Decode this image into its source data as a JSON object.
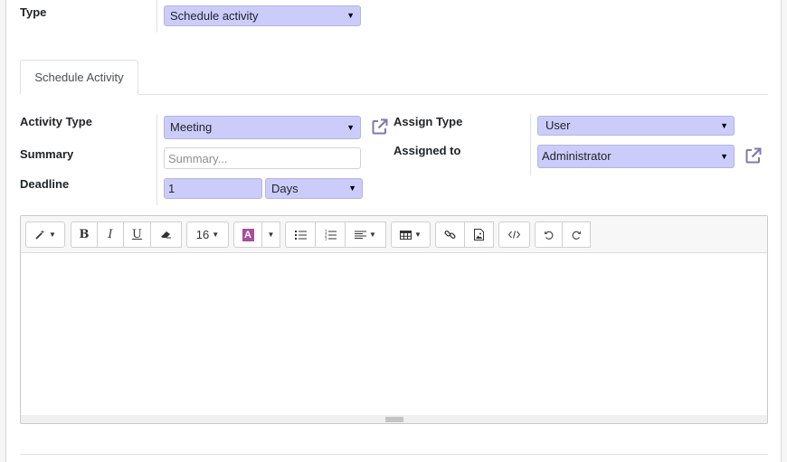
{
  "type_field": {
    "label": "Type",
    "value": "Schedule activity"
  },
  "tabs": [
    {
      "label": "Schedule Activity"
    }
  ],
  "activity_type": {
    "label": "Activity Type",
    "value": "Meeting"
  },
  "summary": {
    "label": "Summary",
    "placeholder": "Summary...",
    "value": ""
  },
  "deadline": {
    "label": "Deadline",
    "value": "1",
    "unit": "Days"
  },
  "assign_type": {
    "label": "Assign Type",
    "value": "User"
  },
  "assigned_to": {
    "label": "Assigned to",
    "value": "Administrator"
  },
  "toolbar": {
    "font_size": "16",
    "icons": [
      "magic-wand-icon",
      "bold-icon",
      "italic-icon",
      "underline-icon",
      "eraser-icon",
      "font-color-icon",
      "bullet-list-icon",
      "numbered-list-icon",
      "align-icon",
      "table-icon",
      "link-icon",
      "image-icon",
      "code-view-icon",
      "undo-icon",
      "redo-icon"
    ],
    "bold": "B",
    "italic": "I",
    "underline": "U",
    "color_letter": "A"
  },
  "colors": {
    "required_bg": "#ccccfb",
    "accent": "#7c7bad",
    "font_color_swatch": "#a4509c"
  }
}
